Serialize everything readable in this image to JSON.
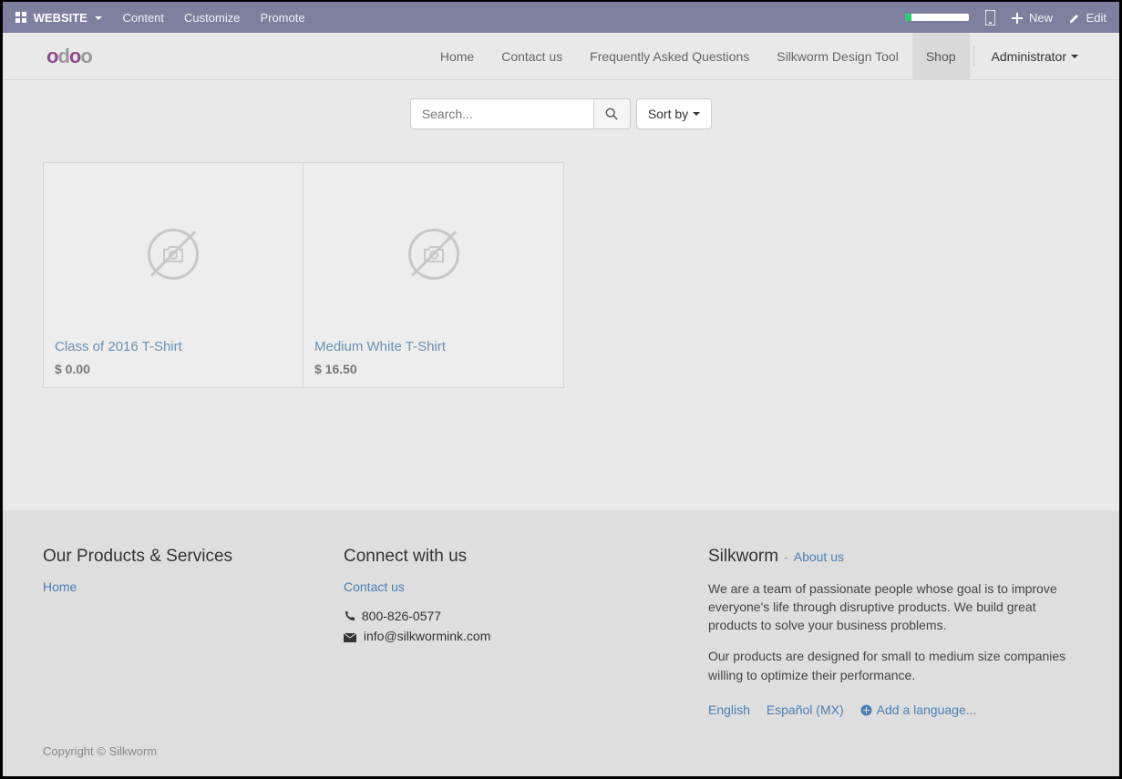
{
  "topbar": {
    "website_label": "WEBSITE",
    "content": "Content",
    "customize": "Customize",
    "promote": "Promote",
    "new": "New",
    "edit": "Edit"
  },
  "nav": {
    "items": [
      "Home",
      "Contact us",
      "Frequently Asked Questions",
      "Silkworm Design Tool",
      "Shop"
    ],
    "admin": "Administrator"
  },
  "search": {
    "placeholder": "Search...",
    "sort_label": "Sort by"
  },
  "products": [
    {
      "title": "Class of 2016 T-Shirt",
      "price": "$ 0.00"
    },
    {
      "title": "Medium White T-Shirt",
      "price": "$ 16.50"
    }
  ],
  "footer": {
    "col1": {
      "heading": "Our Products & Services",
      "home": "Home"
    },
    "col2": {
      "heading": "Connect with us",
      "contact": "Contact us",
      "phone": "800-826-0577",
      "email": "info@silkwormink.com"
    },
    "col3": {
      "company": "Silkworm",
      "about_link": "About us",
      "p1": "We are a team of passionate people whose goal is to improve everyone's life through disruptive products. We build great products to solve your business problems.",
      "p2": "Our products are designed for small to medium size companies willing to optimize their performance.",
      "lang1": "English",
      "lang2": "Español (MX)",
      "addlang": "Add a language..."
    },
    "copyright": "Copyright © Silkworm"
  }
}
